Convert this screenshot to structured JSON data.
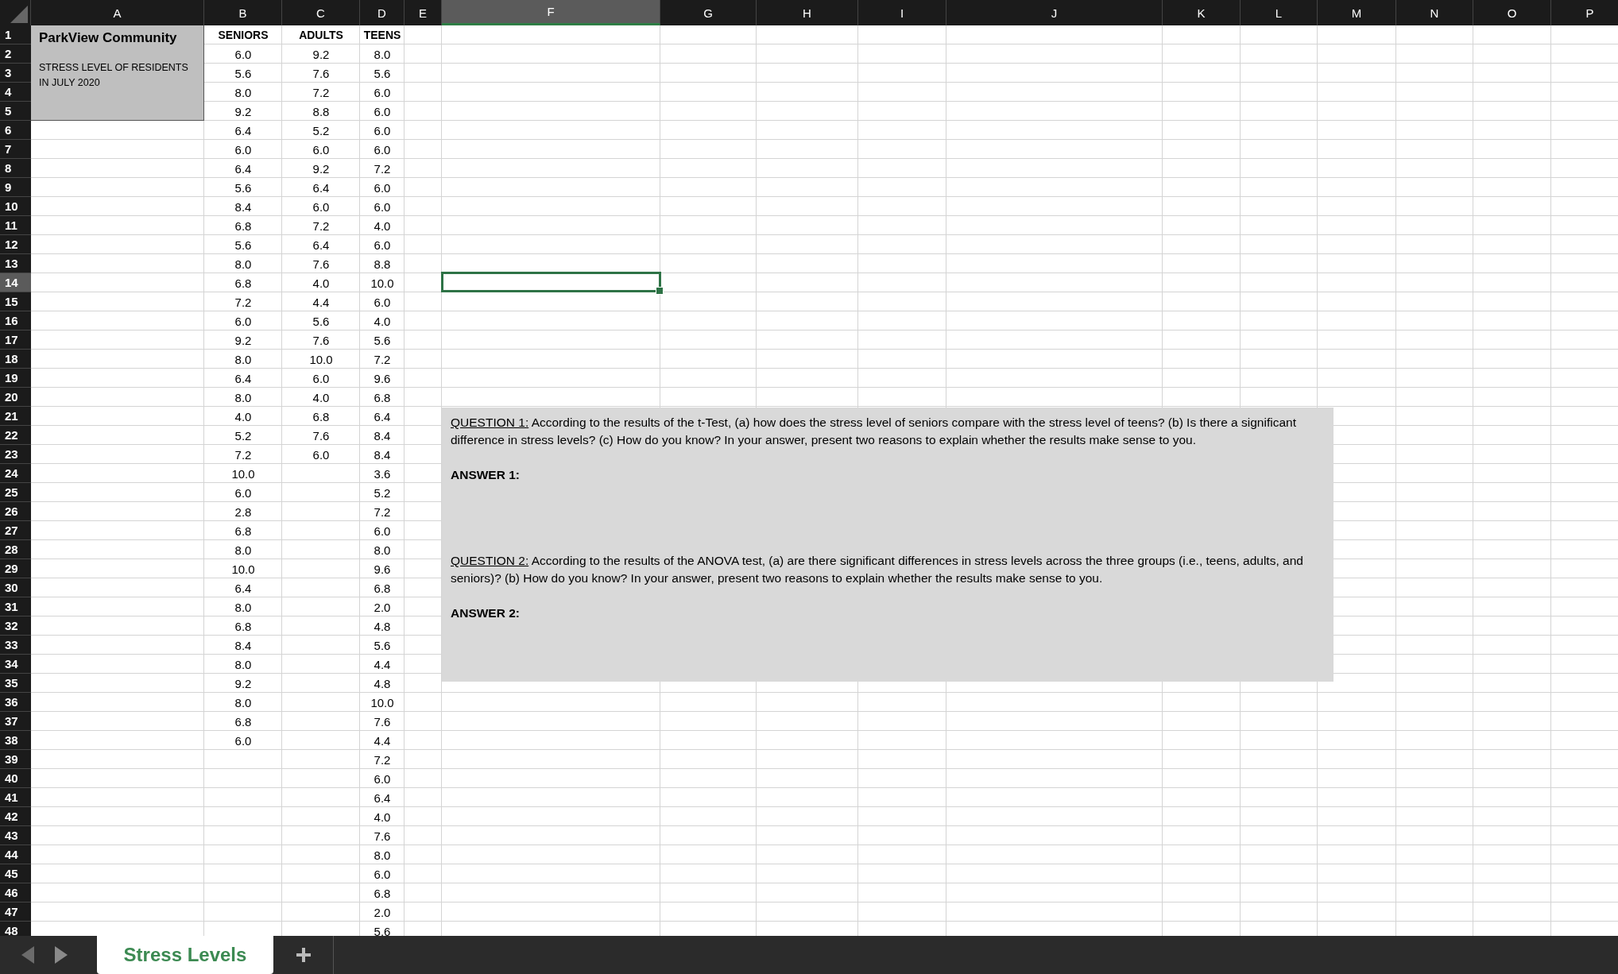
{
  "columns": [
    {
      "letter": "A",
      "selected": false
    },
    {
      "letter": "B",
      "selected": false
    },
    {
      "letter": "C",
      "selected": false
    },
    {
      "letter": "D",
      "selected": false
    },
    {
      "letter": "E",
      "selected": false
    },
    {
      "letter": "F",
      "selected": true
    },
    {
      "letter": "G",
      "selected": false
    },
    {
      "letter": "H",
      "selected": false
    },
    {
      "letter": "I",
      "selected": false
    },
    {
      "letter": "J",
      "selected": false
    },
    {
      "letter": "K",
      "selected": false
    },
    {
      "letter": "L",
      "selected": false
    },
    {
      "letter": "M",
      "selected": false
    },
    {
      "letter": "N",
      "selected": false
    },
    {
      "letter": "O",
      "selected": false
    },
    {
      "letter": "P",
      "selected": false
    }
  ],
  "rows": [
    {
      "label": "1",
      "selected": false
    },
    {
      "label": "2",
      "selected": false
    },
    {
      "label": "3",
      "selected": false
    },
    {
      "label": "4",
      "selected": false
    },
    {
      "label": "5",
      "selected": false
    },
    {
      "label": "6",
      "selected": false
    },
    {
      "label": "7",
      "selected": false
    },
    {
      "label": "8",
      "selected": false
    },
    {
      "label": "9",
      "selected": false
    },
    {
      "label": "10",
      "selected": false
    },
    {
      "label": "11",
      "selected": false
    },
    {
      "label": "12",
      "selected": false
    },
    {
      "label": "13",
      "selected": false
    },
    {
      "label": "14",
      "selected": true
    },
    {
      "label": "15",
      "selected": false
    },
    {
      "label": "16",
      "selected": false
    },
    {
      "label": "17",
      "selected": false
    },
    {
      "label": "18",
      "selected": false
    },
    {
      "label": "19",
      "selected": false
    },
    {
      "label": "20",
      "selected": false
    },
    {
      "label": "21",
      "selected": false
    },
    {
      "label": "22",
      "selected": false
    },
    {
      "label": "23",
      "selected": false
    },
    {
      "label": "24",
      "selected": false
    },
    {
      "label": "25",
      "selected": false
    },
    {
      "label": "26",
      "selected": false
    },
    {
      "label": "27",
      "selected": false
    },
    {
      "label": "28",
      "selected": false
    },
    {
      "label": "29",
      "selected": false
    },
    {
      "label": "30",
      "selected": false
    },
    {
      "label": "31",
      "selected": false
    },
    {
      "label": "32",
      "selected": false
    },
    {
      "label": "33",
      "selected": false
    },
    {
      "label": "34",
      "selected": false
    },
    {
      "label": "35",
      "selected": false
    },
    {
      "label": "36",
      "selected": false
    },
    {
      "label": "37",
      "selected": false
    },
    {
      "label": "38",
      "selected": false
    },
    {
      "label": "39",
      "selected": false
    },
    {
      "label": "40",
      "selected": false
    },
    {
      "label": "41",
      "selected": false
    },
    {
      "label": "42",
      "selected": false
    },
    {
      "label": "43",
      "selected": false
    },
    {
      "label": "44",
      "selected": false
    },
    {
      "label": "45",
      "selected": false
    },
    {
      "label": "46",
      "selected": false
    },
    {
      "label": "47",
      "selected": false
    },
    {
      "label": "48",
      "selected": false
    }
  ],
  "title_block": {
    "title": "ParkView Community",
    "subtitle": "STRESS LEVEL OF RESIDENTS IN JULY 2020"
  },
  "data_columns": [
    {
      "header": "SENIORS",
      "values": [
        "6.0",
        "5.6",
        "8.0",
        "9.2",
        "6.4",
        "6.0",
        "6.4",
        "5.6",
        "8.4",
        "6.8",
        "5.6",
        "8.0",
        "6.8",
        "7.2",
        "6.0",
        "9.2",
        "8.0",
        "6.4",
        "8.0",
        "4.0",
        "5.2",
        "7.2",
        "10.0",
        "6.0",
        "2.8",
        "6.8",
        "8.0",
        "10.0",
        "6.4",
        "8.0",
        "6.8",
        "8.4",
        "8.0",
        "9.2",
        "8.0",
        "6.8",
        "6.0"
      ]
    },
    {
      "header": "ADULTS",
      "values": [
        "9.2",
        "7.6",
        "7.2",
        "8.8",
        "5.2",
        "6.0",
        "9.2",
        "6.4",
        "6.0",
        "7.2",
        "6.4",
        "7.6",
        "4.0",
        "4.4",
        "5.6",
        "7.6",
        "10.0",
        "6.0",
        "4.0",
        "6.8",
        "7.6",
        "6.0"
      ]
    },
    {
      "header": "TEENS",
      "values": [
        "8.0",
        "5.6",
        "6.0",
        "6.0",
        "6.0",
        "6.0",
        "7.2",
        "6.0",
        "6.0",
        "4.0",
        "6.0",
        "8.8",
        "10.0",
        "6.0",
        "4.0",
        "5.6",
        "7.2",
        "9.6",
        "6.8",
        "6.4",
        "8.4",
        "8.4",
        "3.6",
        "5.2",
        "7.2",
        "6.0",
        "8.0",
        "9.6",
        "6.8",
        "2.0",
        "4.8",
        "5.6",
        "4.4",
        "4.8",
        "10.0",
        "7.6",
        "4.4",
        "7.2",
        "6.0",
        "6.4",
        "4.0",
        "7.6",
        "8.0",
        "6.0",
        "6.8",
        "2.0",
        "5.6"
      ]
    }
  ],
  "text_box": [
    {
      "kind": "question",
      "label": "QUESTION 1:",
      "text": "According to the results of the t-Test, (a) how does the stress level of seniors compare with the stress level of teens? (b) Is there a significant difference in stress levels? (c) How do you know? In your answer, present two reasons to explain whether the results make sense to you."
    },
    {
      "kind": "answer",
      "label": "ANSWER 1:"
    },
    {
      "kind": "question",
      "label": "QUESTION 2:",
      "text": "According to the results of the ANOVA test, (a) are there significant differences in stress levels across the three groups (i.e., teens, adults, and seniors)? (b) How do you know? In your answer, present two reasons to explain whether the results make sense to you."
    },
    {
      "kind": "answer",
      "label": "ANSWER 2:"
    }
  ],
  "sheet_tabs": [
    {
      "label": "Stress Levels",
      "selected": true
    }
  ]
}
